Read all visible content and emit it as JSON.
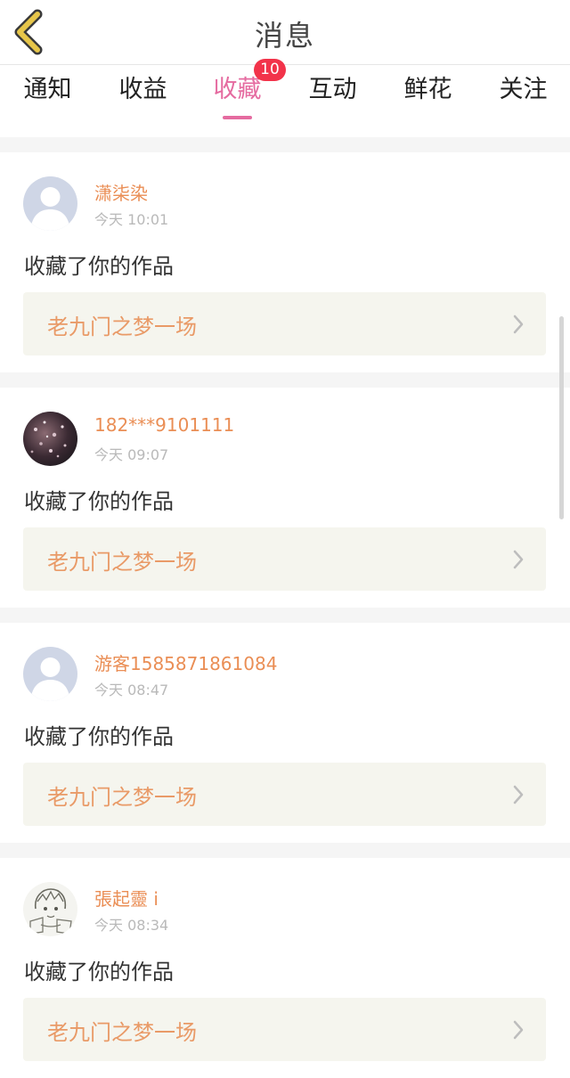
{
  "header": {
    "title": "消息",
    "back_icon": "chevron-left-icon",
    "back_color": "#e7c64a"
  },
  "tabs": [
    {
      "label": "通知"
    },
    {
      "label": "收益"
    },
    {
      "label": "收藏",
      "active": true,
      "badge": "10"
    },
    {
      "label": "互动"
    },
    {
      "label": "鲜花"
    },
    {
      "label": "关注"
    }
  ],
  "colors": {
    "accent": "#e56ba0",
    "badge": "#f2334a",
    "username": "#ea8e55",
    "work_title": "#e99a67"
  },
  "messages": [
    {
      "username": "潇柒染",
      "time": "今天 10:01",
      "action": "收藏了你的作品",
      "work": "老九门之梦一场",
      "avatar": "default-avatar-icon"
    },
    {
      "username": "182***9101111",
      "time": "今天 09:07",
      "action": "收藏了你的作品",
      "work": "老九门之梦一场",
      "avatar": "photo-avatar"
    },
    {
      "username": "游客1585871861084",
      "time": "今天 08:47",
      "action": "收藏了你的作品",
      "work": "老九门之梦一场",
      "avatar": "default-avatar-icon"
    },
    {
      "username": "張起靈 i",
      "time": "今天 08:34",
      "action": "收藏了你的作品",
      "work": "老九门之梦一场",
      "avatar": "sketch-avatar"
    }
  ]
}
